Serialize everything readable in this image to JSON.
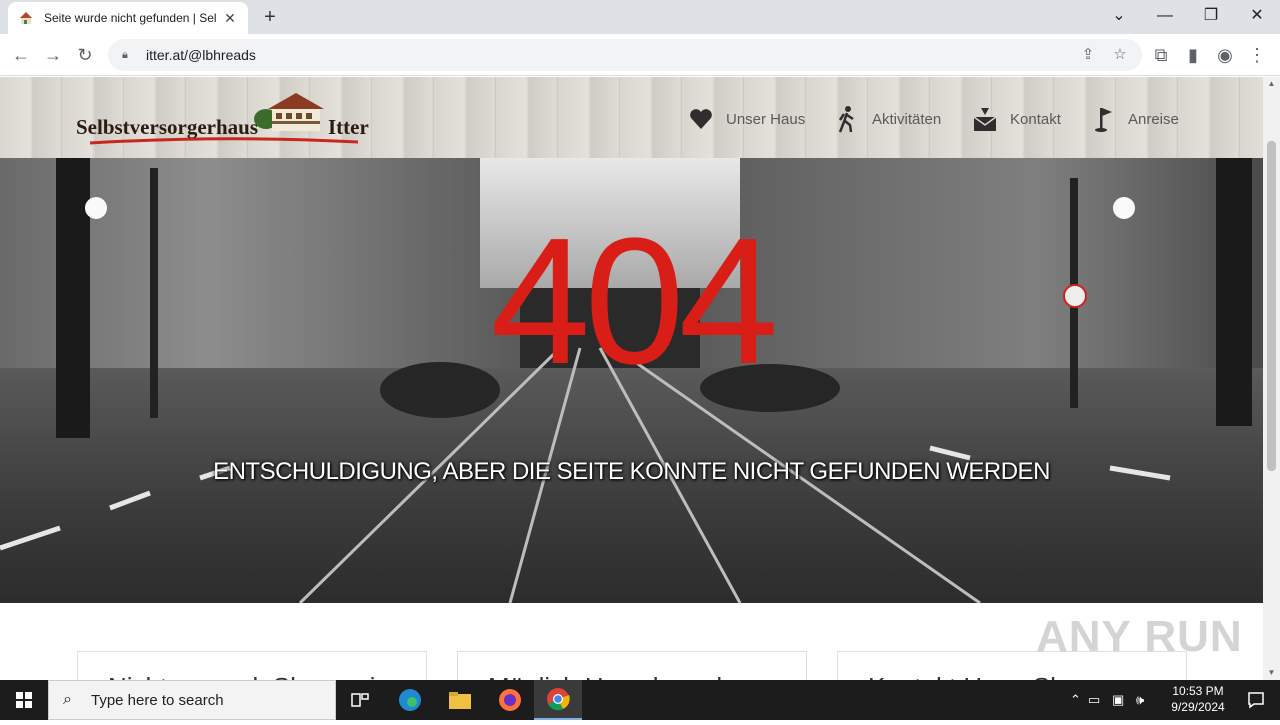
{
  "browser": {
    "tab_title": "Seite wurde nicht gefunden | Sel",
    "url": "itter.at/@lbhreads"
  },
  "site": {
    "logo_text": "Selbstversorgerhaus",
    "logo_text2": "Itter",
    "nav": [
      {
        "label": "Unser Haus",
        "icon": "heart-icon"
      },
      {
        "label": "Aktivitäten",
        "icon": "hiker-icon"
      },
      {
        "label": "Kontakt",
        "icon": "envelope-icon"
      },
      {
        "label": "Anreise",
        "icon": "flag-icon"
      }
    ],
    "error_code": "404",
    "error_message": "ENTSCHULDIGUNG, ABER DIE SEITE KONNTE NICHT GEFUNDEN WERDEN",
    "cards": [
      "Nicht ganz ok Shang ei",
      "Möglich Haus kemal",
      "Kontakt Hona Shau"
    ]
  },
  "watermark": "ANY RUN",
  "taskbar": {
    "search_placeholder": "Type here to search",
    "time": "10:53 PM",
    "date": "9/29/2024"
  },
  "colors": {
    "error_red": "#d81e17",
    "chrome_bg": "#dee1e6",
    "taskbar_bg": "#1c1c1c"
  }
}
